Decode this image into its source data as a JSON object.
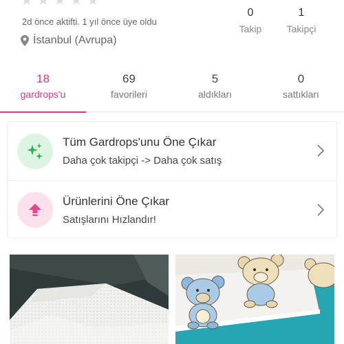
{
  "profile": {
    "rating_stars": 5,
    "activity": "2d önce aktifti. 1 yıl önce üye oldu",
    "location": "İstanbul (Avrupa)",
    "following": {
      "count": "0",
      "label": "Takip"
    },
    "followers": {
      "count": "1",
      "label": "Takipçi"
    }
  },
  "tabs": [
    {
      "count": "18",
      "label": "gardrops'u",
      "active": true
    },
    {
      "count": "69",
      "label": "favorileri",
      "active": false
    },
    {
      "count": "5",
      "label": "aldıkları",
      "active": false
    },
    {
      "count": "0",
      "label": "sattıkları",
      "active": false
    }
  ],
  "promos": [
    {
      "icon": "sparkles-icon",
      "title": "Tüm Gardrops'unu Öne Çıkar",
      "subtitle": "Daha çok takipçi -> Daha çok satış"
    },
    {
      "icon": "arrow-up-icon",
      "title": "Ürünlerini Öne Çıkar",
      "subtitle": "Satışlarını Hızlandır!"
    }
  ],
  "colors": {
    "accent": "#d8378a",
    "green_icon": "#2fb24c",
    "pink_icon": "#e8478f"
  }
}
